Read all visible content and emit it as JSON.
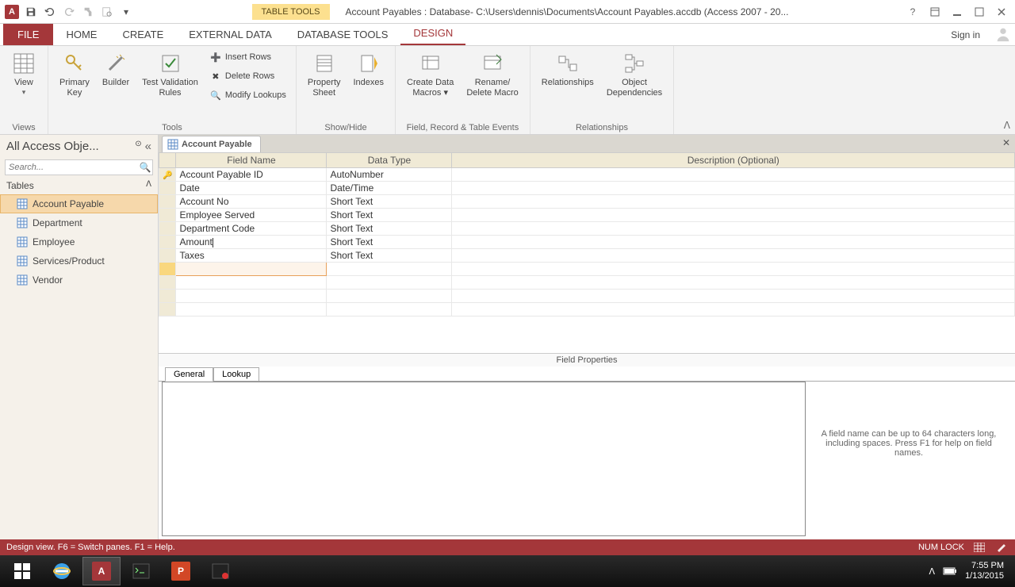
{
  "title_bar": {
    "table_tools": "TABLE TOOLS",
    "title": "Account Payables : Database- C:\\Users\\dennis\\Documents\\Account Payables.accdb (Access 2007 - 20..."
  },
  "ribbon_tabs": {
    "file": "FILE",
    "tabs": [
      "HOME",
      "CREATE",
      "EXTERNAL DATA",
      "DATABASE TOOLS",
      "DESIGN"
    ],
    "active": "DESIGN",
    "sign_in": "Sign in"
  },
  "ribbon": {
    "views": {
      "view": "View",
      "group": "Views"
    },
    "tools": {
      "primary_key": "Primary\nKey",
      "builder": "Builder",
      "test_rules": "Test Validation\nRules",
      "insert_rows": "Insert Rows",
      "delete_rows": "Delete Rows",
      "modify_lookups": "Modify Lookups",
      "group": "Tools"
    },
    "show_hide": {
      "property_sheet": "Property\nSheet",
      "indexes": "Indexes",
      "group": "Show/Hide"
    },
    "events": {
      "create_macros": "Create Data\nMacros ▾",
      "rename_delete": "Rename/\nDelete Macro",
      "group": "Field, Record & Table Events"
    },
    "relationships": {
      "relationships": "Relationships",
      "object_deps": "Object\nDependencies",
      "group": "Relationships"
    }
  },
  "nav": {
    "header": "All Access Obje...",
    "search_placeholder": "Search...",
    "group": "Tables",
    "items": [
      "Account Payable",
      "Department",
      "Employee",
      "Services/Product",
      "Vendor"
    ],
    "selected": "Account Payable"
  },
  "document": {
    "tab": "Account Payable",
    "columns": {
      "field_name": "Field Name",
      "data_type": "Data Type",
      "description": "Description (Optional)"
    },
    "rows": [
      {
        "pk": true,
        "field": "Account Payable ID",
        "type": "AutoNumber",
        "desc": ""
      },
      {
        "pk": false,
        "field": "Date",
        "type": "Date/Time",
        "desc": ""
      },
      {
        "pk": false,
        "field": "Account No",
        "type": "Short Text",
        "desc": ""
      },
      {
        "pk": false,
        "field": "Employee Served",
        "type": "Short Text",
        "desc": ""
      },
      {
        "pk": false,
        "field": "Department Code",
        "type": "Short Text",
        "desc": ""
      },
      {
        "pk": false,
        "field": "Amount",
        "type": "Short Text",
        "desc": ""
      },
      {
        "pk": false,
        "field": "Taxes",
        "type": "Short Text",
        "desc": ""
      }
    ],
    "field_props_header": "Field Properties",
    "prop_tabs": {
      "general": "General",
      "lookup": "Lookup"
    },
    "help_text": "A field name can be up to 64 characters long, including spaces. Press F1 for help on field names."
  },
  "status": {
    "left": "Design view.   F6 = Switch panes.   F1 = Help.",
    "numlock": "NUM LOCK"
  },
  "taskbar": {
    "time": "7:55 PM",
    "date": "1/13/2015"
  }
}
